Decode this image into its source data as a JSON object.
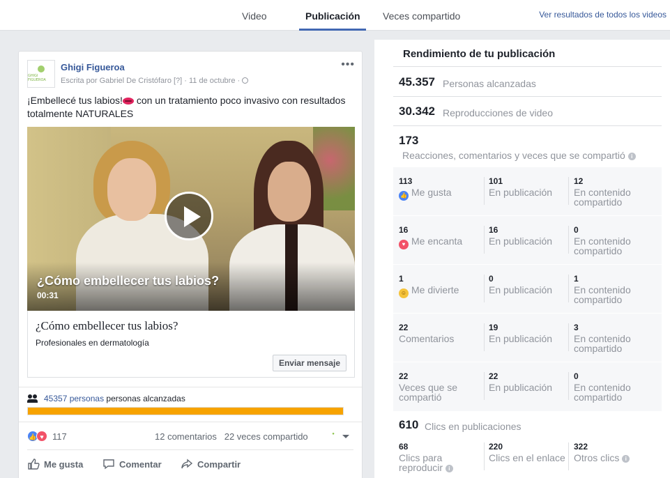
{
  "tabs": [
    {
      "label": "Video"
    },
    {
      "label": "Publicación"
    },
    {
      "label": "Veces compartido"
    }
  ],
  "top_link": "Ver resultados de todos los videos",
  "post": {
    "page_name": "Ghigi Figueroa",
    "logo_text": "GHIGI FIGUEROA",
    "byline": "Escrita por Gabriel De Cristófaro [?] · 11 de octubre ·",
    "text_before": "¡Embellecé tus labios!",
    "text_after": " con un tratamiento poco invasivo con resultados totalmente NATURALES",
    "video_title": "¿Cómo embellecer tus labios?",
    "video_duration": "00:31",
    "link_title": "¿Cómo embellecer tus labios?",
    "link_subtitle": "Profesionales en dermatología",
    "message_button": "Enviar mensaje",
    "reach_count": "45357 personas",
    "reach_label": " personas alcanzadas",
    "reach_fraction": 1.0,
    "reactions_count": "117",
    "comments_shares": "12 comentarios   22 veces compartido",
    "actions": {
      "like": "Me gusta",
      "comment": "Comentar",
      "share": "Compartir"
    }
  },
  "panel": {
    "title": "Rendimiento de tu publicación",
    "reached_num": "45.357",
    "reached_lbl": "Personas alcanzadas",
    "views_num": "30.342",
    "views_lbl": "Reproducciones de video",
    "engagement_num": "173",
    "engagement_lbl": "Reacciones, comentarios y veces que se compartió",
    "rows": [
      {
        "n1": "113",
        "l1": "Me gusta",
        "n2": "101",
        "l2": "En publicación",
        "n3": "12",
        "l3": "En contenido compartido"
      },
      {
        "n1": "16",
        "l1": "Me encanta",
        "n2": "16",
        "l2": "En publicación",
        "n3": "0",
        "l3": "En contenido compartido"
      },
      {
        "n1": "1",
        "l1": "Me divierte",
        "n2": "0",
        "l2": "En publicación",
        "n3": "1",
        "l3": "En contenido compartido"
      },
      {
        "n1": "22",
        "l1": "Comentarios",
        "n2": "19",
        "l2": "En publicación",
        "n3": "3",
        "l3": "En contenido compartido"
      },
      {
        "n1": "22",
        "l1": "Veces que se compartió",
        "n2": "22",
        "l2": "En publicación",
        "n3": "0",
        "l3": "En contenido compartido"
      }
    ],
    "clicks_num": "610",
    "clicks_lbl": "Clics en publicaciones",
    "clicks": {
      "n1": "68",
      "l1": "Clics para reproducir",
      "n2": "220",
      "l2": "Clics en el enlace",
      "n3": "322",
      "l3": "Otros clics"
    }
  },
  "colors": {
    "accent": "#4267b2",
    "link": "#365899",
    "progress": "#f7a300"
  }
}
